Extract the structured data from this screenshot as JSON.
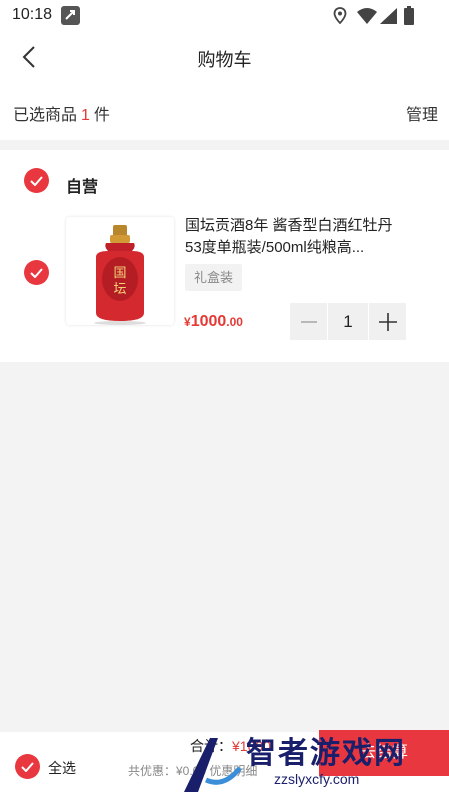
{
  "status_bar": {
    "time": "10:18",
    "icons": [
      "app-notification-icon",
      "location-icon",
      "wifi-icon",
      "signal-icon",
      "battery-icon"
    ]
  },
  "header": {
    "title": "购物车",
    "back_icon": "chevron-left-icon"
  },
  "selection_bar": {
    "prefix": "已选商品",
    "count": "1",
    "suffix": "件",
    "manage_label": "管理"
  },
  "store": {
    "name": "自营",
    "checked": true,
    "items": [
      {
        "checked": true,
        "name": "国坛贡酒8年 酱香型白酒红牡丹53度单瓶装/500ml纯粮高...",
        "spec": "礼盒装",
        "price_symbol": "¥",
        "price_integer": "1000",
        "price_decimal": ".00",
        "quantity": "1"
      }
    ]
  },
  "bottom_bar": {
    "select_all_label": "全选",
    "total_label": "合计：",
    "total_amount": "¥1000",
    "promo_text": "共优惠：¥0.00 优惠明细",
    "checkout_label": "去结算"
  },
  "watermark": {
    "title": "智者游戏网",
    "url": "zzslyxcfy.com"
  },
  "colors": {
    "accent": "#e8373f",
    "price": "#e53935",
    "background": "#f3f3f3",
    "watermark": "#1a1f6b"
  }
}
